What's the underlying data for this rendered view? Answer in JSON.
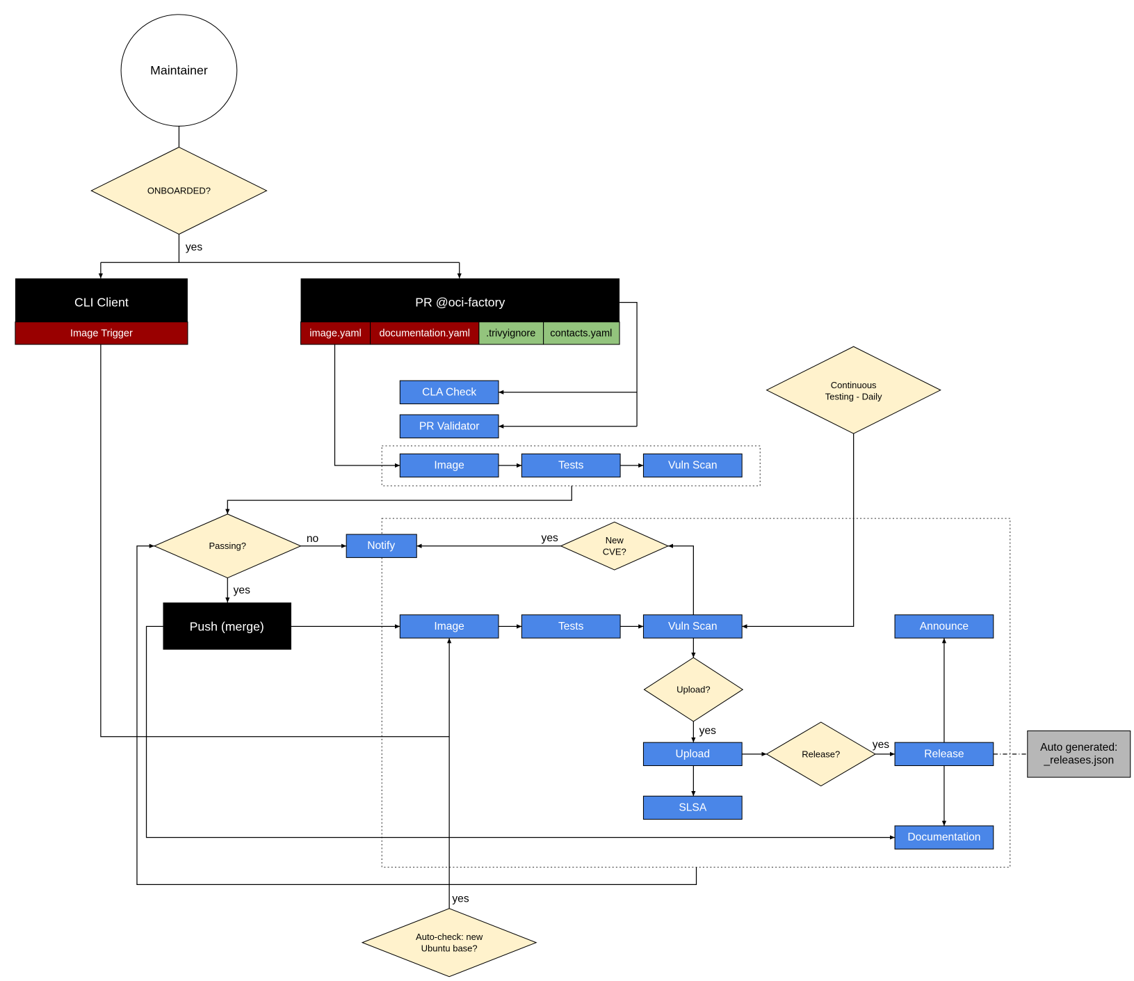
{
  "colors": {
    "process": "#4a86e8",
    "decision": "#fff2cc",
    "required_file": "#990000",
    "optional_file": "#93c47d",
    "actor_box": "#000000",
    "generated": "#b7b7b7"
  },
  "nodes": {
    "maintainer": "Maintainer",
    "onboarded": "ONBOARDED?",
    "cli_client": "CLI Client",
    "image_trigger": "Image Trigger",
    "pr": "PR @oci-factory",
    "files": [
      "image.yaml",
      "documentation.yaml",
      ".trivyignore",
      "contacts.yaml"
    ],
    "cla_check": "CLA Check",
    "pr_validator": "PR Validator",
    "pr_image": "Image",
    "pr_tests": "Tests",
    "pr_vuln": "Vuln Scan",
    "continuous": [
      "Continuous",
      "Testing - Daily"
    ],
    "passing": "Passing?",
    "notify": "Notify",
    "new_cve": [
      "New",
      "CVE?"
    ],
    "push": "Push (merge)",
    "image": "Image",
    "tests": "Tests",
    "vuln": "Vuln Scan",
    "announce": "Announce",
    "upload_q": "Upload?",
    "upload": "Upload",
    "slsa": "SLSA",
    "release_q": "Release?",
    "release": "Release",
    "documentation": "Documentation",
    "auto_generated": [
      "Auto generated:",
      "_releases.json"
    ],
    "auto_check": [
      "Auto-check: new",
      "Ubuntu base?"
    ]
  },
  "edge_labels": {
    "onboarded_yes": "yes",
    "passing_no": "no",
    "passing_yes": "yes",
    "cve_yes": "yes",
    "upload_yes": "yes",
    "release_yes": "yes",
    "autocheck_yes": "yes"
  }
}
